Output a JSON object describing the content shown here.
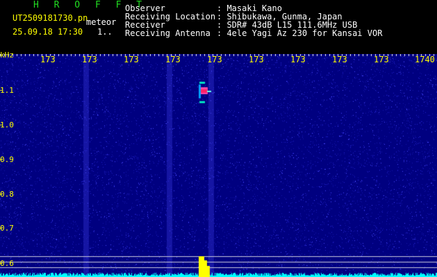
{
  "header": {
    "app_name": "H R O F F T",
    "filename": "UT2509181730.pn",
    "meteor_label": "meteor",
    "datetime": "25.09.18 17:30",
    "counter": "1..",
    "fields": [
      {
        "label": "Observer",
        "value": ": Masaki Kano"
      },
      {
        "label": "Receiving Location",
        "value": ": Shibukawa, Gunma, Japan"
      },
      {
        "label": "Receiver",
        "value": ": SDR# 43dB L15 111.6MHz USB"
      },
      {
        "label": "Receiving Antenna",
        "value": ": 4ele Yagi Az 230 for Kansai VOR"
      }
    ]
  },
  "axes": {
    "y_unit": "kHz",
    "y_ticks": [
      "1.1",
      "1.0",
      "0.9",
      "0.8",
      "0.7",
      "0.6"
    ],
    "x_ticks": [
      "173",
      "173",
      "173",
      "173",
      "173",
      "173",
      "173",
      "173",
      "173",
      "1740"
    ]
  },
  "colors": {
    "background": "#000080",
    "noise": "#2c2cff",
    "trace": "#00ffff",
    "burst": "#ffff00",
    "echo_core": "#ff2266",
    "echo_edge": "#00e0c0"
  }
}
